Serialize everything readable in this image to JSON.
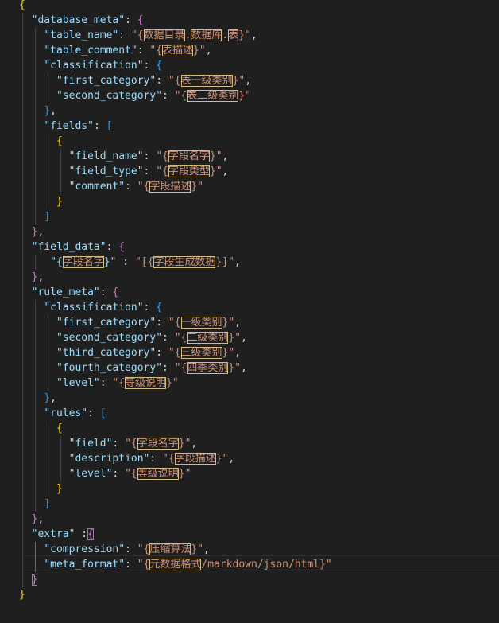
{
  "editor": {
    "language": "json",
    "colors": {
      "background": "#1f1f1f",
      "key": "#9cdcfe",
      "string": "#ce9178",
      "punctuation": "#d4d4d4",
      "bracket_level_1": "#ffd700",
      "bracket_level_2": "#da70d6",
      "bracket_level_3": "#179fff",
      "highlight_box": "#d7ba7d"
    },
    "lines": [
      [
        [
          "{",
          "b1"
        ]
      ],
      [
        [
          "  ",
          "p"
        ],
        [
          "\"database_meta\"",
          "k"
        ],
        [
          ": ",
          "p"
        ],
        [
          "{",
          "b2"
        ]
      ],
      [
        [
          "    ",
          "p"
        ],
        [
          "\"table_name\"",
          "k"
        ],
        [
          ": ",
          "p"
        ],
        [
          "\"{",
          "s"
        ],
        [
          "数据目录",
          "hl"
        ],
        [
          ".",
          "s"
        ],
        [
          "数据库",
          "hl"
        ],
        [
          ".",
          "s"
        ],
        [
          "表",
          "hl"
        ],
        [
          "}\"",
          "s"
        ],
        [
          ",",
          "p"
        ]
      ],
      [
        [
          "    ",
          "p"
        ],
        [
          "\"table_comment\"",
          "k"
        ],
        [
          ": ",
          "p"
        ],
        [
          "\"{",
          "s"
        ],
        [
          "表描述",
          "hl"
        ],
        [
          "}\"",
          "s"
        ],
        [
          ",",
          "p"
        ]
      ],
      [
        [
          "    ",
          "p"
        ],
        [
          "\"classification\"",
          "k"
        ],
        [
          ": ",
          "p"
        ],
        [
          "{",
          "b3"
        ]
      ],
      [
        [
          "      ",
          "p"
        ],
        [
          "\"first_category\"",
          "k"
        ],
        [
          ": ",
          "p"
        ],
        [
          "\"{",
          "s"
        ],
        [
          "表一级类别",
          "hl"
        ],
        [
          "}\"",
          "s"
        ],
        [
          ",",
          "p"
        ]
      ],
      [
        [
          "      ",
          "p"
        ],
        [
          "\"second_category\"",
          "k"
        ],
        [
          ": ",
          "p"
        ],
        [
          "\"{",
          "s"
        ],
        [
          "表二级类别",
          "hl"
        ],
        [
          "}\"",
          "s"
        ]
      ],
      [
        [
          "    ",
          "p"
        ],
        [
          "}",
          "b3"
        ],
        [
          ",",
          "p"
        ]
      ],
      [
        [
          "    ",
          "p"
        ],
        [
          "\"fields\"",
          "k"
        ],
        [
          ": ",
          "p"
        ],
        [
          "[",
          "b3"
        ]
      ],
      [
        [
          "      ",
          "p"
        ],
        [
          "{",
          "b1"
        ]
      ],
      [
        [
          "        ",
          "p"
        ],
        [
          "\"field_name\"",
          "k"
        ],
        [
          ": ",
          "p"
        ],
        [
          "\"{",
          "s"
        ],
        [
          "字段名字",
          "hl"
        ],
        [
          "}\"",
          "s"
        ],
        [
          ",",
          "p"
        ]
      ],
      [
        [
          "        ",
          "p"
        ],
        [
          "\"field_type\"",
          "k"
        ],
        [
          ": ",
          "p"
        ],
        [
          "\"{",
          "s"
        ],
        [
          "字段类型",
          "hl"
        ],
        [
          "}\"",
          "s"
        ],
        [
          ",",
          "p"
        ]
      ],
      [
        [
          "        ",
          "p"
        ],
        [
          "\"comment\"",
          "k"
        ],
        [
          ": ",
          "p"
        ],
        [
          "\"{",
          "s"
        ],
        [
          "字段描述",
          "hl"
        ],
        [
          "}\"",
          "s"
        ]
      ],
      [
        [
          "      ",
          "p"
        ],
        [
          "}",
          "b1"
        ]
      ],
      [
        [
          "    ",
          "p"
        ],
        [
          "]",
          "b3"
        ]
      ],
      [
        [
          "  ",
          "p"
        ],
        [
          "}",
          "b2"
        ],
        [
          ",",
          "p"
        ]
      ],
      [
        [
          "  ",
          "p"
        ],
        [
          "\"field_data\"",
          "k"
        ],
        [
          ": ",
          "p"
        ],
        [
          "{",
          "b2"
        ]
      ],
      [
        [
          "     ",
          "p"
        ],
        [
          "\"{",
          "k"
        ],
        [
          "字段名字",
          "hl"
        ],
        [
          "}\"",
          "k"
        ],
        [
          " : ",
          "p"
        ],
        [
          "\"[{",
          "s"
        ],
        [
          "字段生成数据",
          "hl"
        ],
        [
          "}]\"",
          "s"
        ],
        [
          ",",
          "p"
        ]
      ],
      [
        [
          "  ",
          "p"
        ],
        [
          "}",
          "b2"
        ],
        [
          ",",
          "p"
        ]
      ],
      [
        [
          "  ",
          "p"
        ],
        [
          "\"rule_meta\"",
          "k"
        ],
        [
          ": ",
          "p"
        ],
        [
          "{",
          "b2"
        ]
      ],
      [
        [
          "    ",
          "p"
        ],
        [
          "\"classification\"",
          "k"
        ],
        [
          ": ",
          "p"
        ],
        [
          "{",
          "b3"
        ]
      ],
      [
        [
          "      ",
          "p"
        ],
        [
          "\"first_category\"",
          "k"
        ],
        [
          ": ",
          "p"
        ],
        [
          "\"{",
          "s"
        ],
        [
          "一级类别",
          "hl"
        ],
        [
          "}\"",
          "s"
        ],
        [
          ",",
          "p"
        ]
      ],
      [
        [
          "      ",
          "p"
        ],
        [
          "\"second_category\"",
          "k"
        ],
        [
          ": ",
          "p"
        ],
        [
          "\"{",
          "s"
        ],
        [
          "二级类别",
          "hl"
        ],
        [
          "}\"",
          "s"
        ],
        [
          ",",
          "p"
        ]
      ],
      [
        [
          "      ",
          "p"
        ],
        [
          "\"third_category\"",
          "k"
        ],
        [
          ": ",
          "p"
        ],
        [
          "\"{",
          "s"
        ],
        [
          "三级类别",
          "hl"
        ],
        [
          "}\"",
          "s"
        ],
        [
          ",",
          "p"
        ]
      ],
      [
        [
          "      ",
          "p"
        ],
        [
          "\"fourth_category\"",
          "k"
        ],
        [
          ": ",
          "p"
        ],
        [
          "\"{",
          "s"
        ],
        [
          "四季类别",
          "hl"
        ],
        [
          "}\"",
          "s"
        ],
        [
          ",",
          "p"
        ]
      ],
      [
        [
          "      ",
          "p"
        ],
        [
          "\"level\"",
          "k"
        ],
        [
          ": ",
          "p"
        ],
        [
          "\"{",
          "s"
        ],
        [
          "等级说明",
          "hl"
        ],
        [
          "}\"",
          "s"
        ]
      ],
      [
        [
          "    ",
          "p"
        ],
        [
          "}",
          "b3"
        ],
        [
          ",",
          "p"
        ]
      ],
      [
        [
          "    ",
          "p"
        ],
        [
          "\"rules\"",
          "k"
        ],
        [
          ": ",
          "p"
        ],
        [
          "[",
          "b3"
        ]
      ],
      [
        [
          "      ",
          "p"
        ],
        [
          "{",
          "b1"
        ]
      ],
      [
        [
          "        ",
          "p"
        ],
        [
          "\"field\"",
          "k"
        ],
        [
          ": ",
          "p"
        ],
        [
          "\"{",
          "s"
        ],
        [
          "字段名字",
          "hl"
        ],
        [
          "}\"",
          "s"
        ],
        [
          ",",
          "p"
        ]
      ],
      [
        [
          "        ",
          "p"
        ],
        [
          "\"description\"",
          "k"
        ],
        [
          ": ",
          "p"
        ],
        [
          "\"{",
          "s"
        ],
        [
          "字段描述",
          "hl"
        ],
        [
          "}\"",
          "s"
        ],
        [
          ",",
          "p"
        ]
      ],
      [
        [
          "        ",
          "p"
        ],
        [
          "\"level\"",
          "k"
        ],
        [
          ": ",
          "p"
        ],
        [
          "\"{",
          "s"
        ],
        [
          "等级说明",
          "hl"
        ],
        [
          "}\"",
          "s"
        ]
      ],
      [
        [
          "      ",
          "p"
        ],
        [
          "}",
          "b1"
        ]
      ],
      [
        [
          "    ",
          "p"
        ],
        [
          "]",
          "b3"
        ]
      ],
      [
        [
          "  ",
          "p"
        ],
        [
          "}",
          "b2"
        ],
        [
          ",",
          "p"
        ]
      ],
      [
        [
          "  ",
          "p"
        ],
        [
          "\"extra\"",
          "k"
        ],
        [
          " :",
          "p"
        ],
        [
          "{",
          "b2",
          "match"
        ]
      ],
      [
        [
          "    ",
          "p"
        ],
        [
          "\"compression\"",
          "k"
        ],
        [
          ": ",
          "p"
        ],
        [
          "\"{",
          "s"
        ],
        [
          "压缩算法",
          "hl"
        ],
        [
          "}\"",
          "s"
        ],
        [
          ",",
          "p"
        ]
      ],
      [
        [
          "    ",
          "p"
        ],
        [
          "\"meta_format\"",
          "k"
        ],
        [
          ": ",
          "p"
        ],
        [
          "\"{",
          "s"
        ],
        [
          "元数据格式",
          "hl"
        ],
        [
          "/markdown/json/html}\"",
          "s"
        ]
      ],
      [
        [
          "  ",
          "p"
        ],
        [
          "}",
          "b2",
          "match"
        ]
      ],
      [
        [
          "}",
          "b1"
        ]
      ]
    ]
  }
}
